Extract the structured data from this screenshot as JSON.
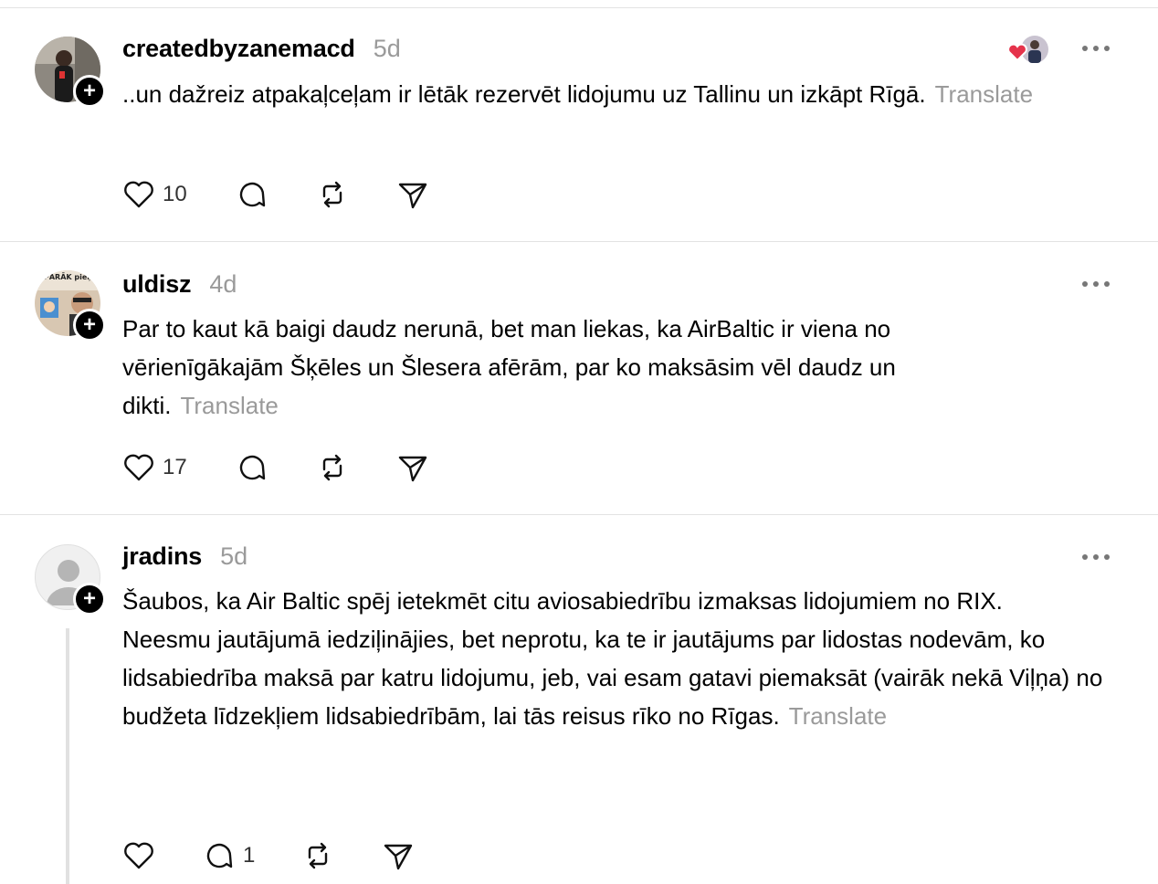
{
  "posts": [
    {
      "username": "createdbyzanemacd",
      "time": "5d",
      "text": "..un dažreiz atpakaļceļam ir lētāk rezervēt lidojumu uz Tallinu un izkāpt Rīgā.",
      "translate": "Translate",
      "likes": "10",
      "replies": "",
      "follow": "+"
    },
    {
      "username": "uldisz",
      "time": "4d",
      "text": "Par to kaut kā baigi daudz nerunā, bet man liekas, ka AirBaltic ir viena no vērienīgākajām Šķēles un Šlesera afērām, par ko maksāsim vēl daudz un dikti.",
      "translate": "Translate",
      "likes": "17",
      "replies": "",
      "follow": "+",
      "avatar_text": "PĀRĀK pieņemties svarā"
    },
    {
      "username": "jradins",
      "time": "5d",
      "text_line1": "Šaubos, ka Air Baltic spēj ietekmēt citu aviosabiedrību izmaksas lidojumiem no RIX.",
      "text_line2": "Neesmu jautājumā iedziļinājies, bet neprotu, ka te ir jautājums par lidostas nodevām, ko lidsabiedrība maksā par katru lidojumu, jeb, vai esam gatavi piemaksāt (vairāk nekā Viļņa) no budžeta līdzekļiem lidsabiedrībām, lai tās reisus rīko no Rīgas.",
      "translate": "Translate",
      "likes": "",
      "replies": "1",
      "follow": "+"
    }
  ],
  "colors": {
    "muted": "#9a9a9a",
    "divider": "#e3e3e3",
    "heart_reaction": "#e5334b"
  },
  "icons": [
    "heart-icon",
    "comment-icon",
    "repost-icon",
    "share-icon",
    "more-icon",
    "follow-plus-icon",
    "default-avatar-icon"
  ]
}
